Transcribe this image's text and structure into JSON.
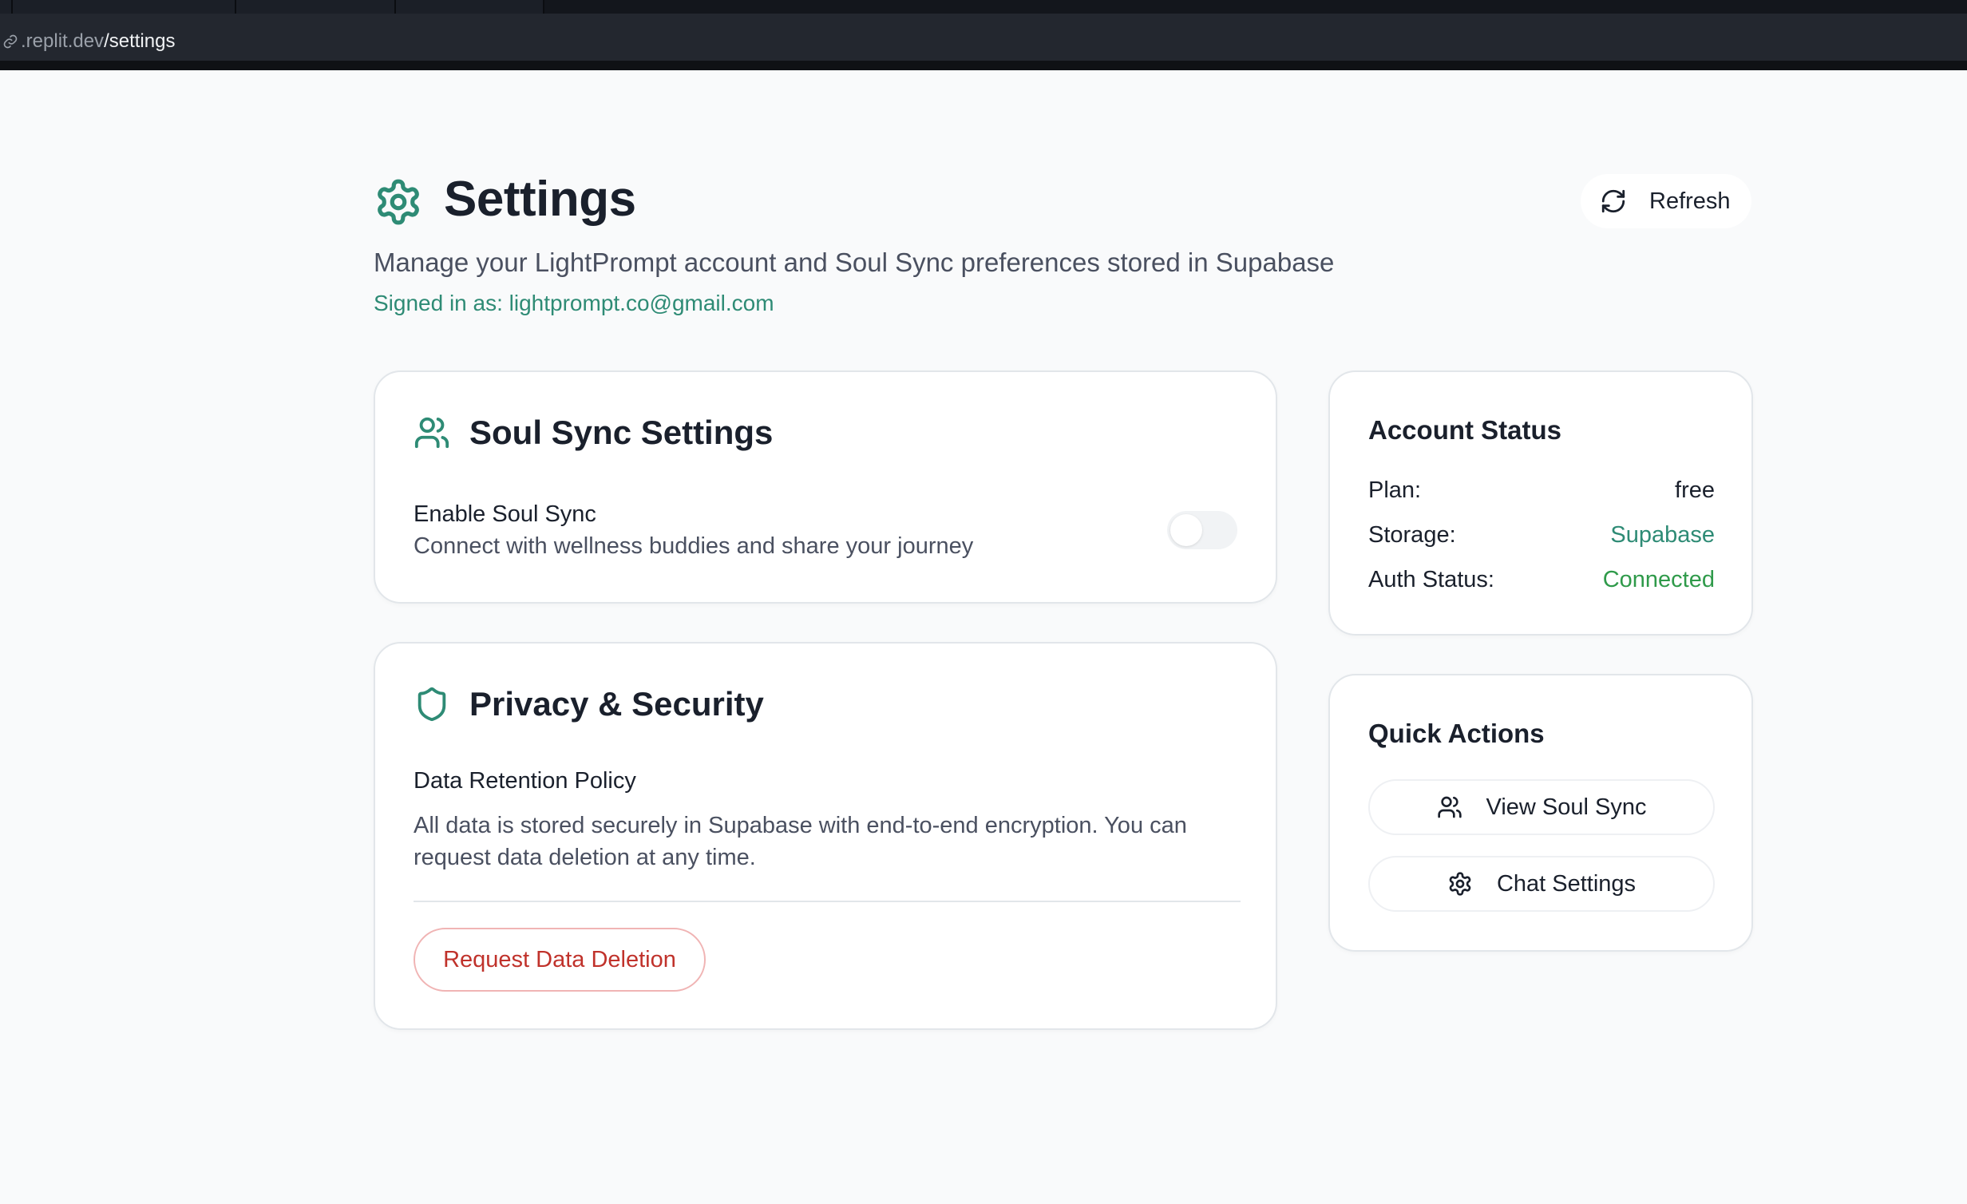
{
  "browser": {
    "url_host": ".replit.dev",
    "url_path": "/settings"
  },
  "header": {
    "title": "Settings",
    "subtitle": "Manage your LightPrompt account and Soul Sync preferences stored in Supabase",
    "signed_in": "Signed in as: lightprompt.co@gmail.com",
    "refresh_label": "Refresh"
  },
  "soul_sync": {
    "title": "Soul Sync Settings",
    "enable_label": "Enable Soul Sync",
    "enable_desc": "Connect with wellness buddies and share your journey",
    "enabled": false
  },
  "privacy": {
    "title": "Privacy & Security",
    "policy_label": "Data Retention Policy",
    "policy_desc_line1": "All data is stored securely in Supabase with end-to-end encryption. You can",
    "policy_desc_line2": "request data deletion at any time.",
    "delete_button": "Request Data Deletion"
  },
  "account": {
    "title": "Account Status",
    "rows": [
      {
        "key": "Plan:",
        "value": "free"
      },
      {
        "key": "Storage:",
        "value": "Supabase"
      },
      {
        "key": "Auth Status:",
        "value": "Connected"
      }
    ]
  },
  "quick_actions": {
    "title": "Quick Actions",
    "items": [
      {
        "label": "View Soul Sync",
        "icon": "users-icon"
      },
      {
        "label": "Chat Settings",
        "icon": "gear-icon"
      }
    ]
  },
  "colors": {
    "accent_teal": "#2e8b75",
    "success_green": "#2f9a4a",
    "danger_red": "#c0322b"
  }
}
